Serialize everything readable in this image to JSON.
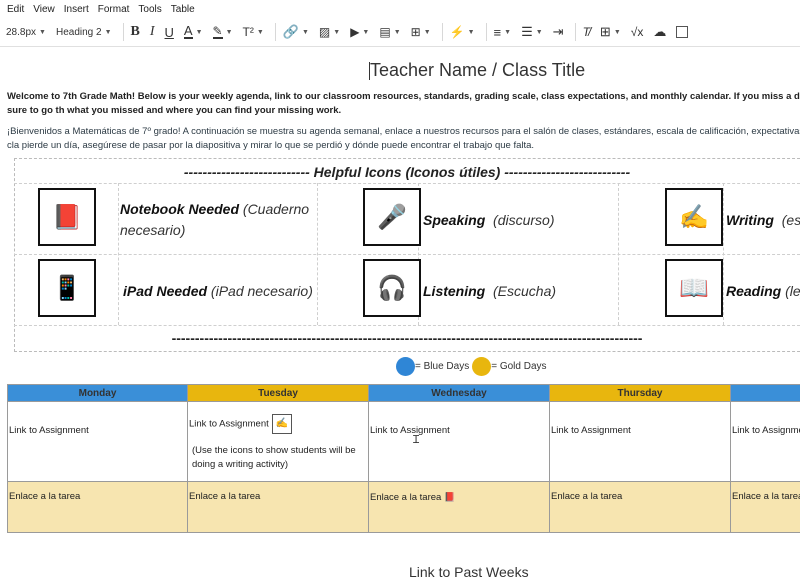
{
  "menubar": {
    "items": [
      "Edit",
      "View",
      "Insert",
      "Format",
      "Tools",
      "Table"
    ]
  },
  "toolbar": {
    "font_size": "28.8px",
    "block_format": "Heading 2",
    "bold_glyph": "B",
    "italic_glyph": "I",
    "underline_glyph": "U",
    "superscript_glyph": "T²"
  },
  "doc": {
    "title": "Teacher Name / Class Title",
    "intro_en": "Welcome to 7th Grade Math! Below is your weekly agenda, link to our classroom resources, standards, grading scale, class expectations, and monthly calendar. If you miss a day be sure to go th what you missed and where you can find your missing work.",
    "intro_es": "¡Bienvenidos a Matemáticas de 7º grado! A continuación se muestra su agenda semanal, enlace a nuestros recursos para el salón de clases, estándares, escala de calificación, expectativas de la cla pierde un día, asegúrese de pasar por la diapositiva y mirar lo que se perdió y dónde puede encontrar el trabajo que falta.",
    "icons_heading": "--------------------------- Helpful Icons (Iconos útiles) ---------------------------",
    "icons_footer": "-----------------------------------------------------------------------------------------------------",
    "icons": [
      {
        "icon": "notebook-icon",
        "glyph": "📕",
        "bold": "Notebook Needed",
        "italic": " (Cuaderno necesario)"
      },
      {
        "icon": "microphone-icon",
        "glyph": "🎤",
        "bold": "Speaking",
        "italic": "  (discurso)"
      },
      {
        "icon": "writing-hand-icon",
        "glyph": "✍",
        "bold": "Writing",
        "italic": "  (esc"
      },
      {
        "icon": "ipad-icon",
        "glyph": "📱",
        "bold": "iPad Needed",
        "italic": " (iPad necesario)"
      },
      {
        "icon": "headphones-icon",
        "glyph": "🎧",
        "bold": "Listening",
        "italic": "  (Escucha)"
      },
      {
        "icon": "book-icon",
        "glyph": "📖",
        "bold": "Reading",
        "italic": " (leye"
      }
    ],
    "legend": {
      "blue": "= Blue Days",
      "gold": "= Gold Days",
      "blue_color": "#2f86d6",
      "gold_color": "#e8b60e"
    },
    "schedule": {
      "days": [
        "Monday",
        "Tuesday",
        "Wednesday",
        "Thursday",
        ""
      ],
      "row1": [
        "Link to Assignment",
        "Link to Assignment",
        "Link to Assignment",
        "Link to Assignment",
        "Link to Assignme"
      ],
      "tuesday_note": "(Use the icons to show students will be doing a writing activity)",
      "row2": [
        "Enlace a la tarea",
        "Enlace a la tarea",
        "Enlace a la tarea",
        "Enlace a la tarea",
        "Enlace a la tarea"
      ]
    },
    "past_weeks": "Link to Past Weeks"
  }
}
